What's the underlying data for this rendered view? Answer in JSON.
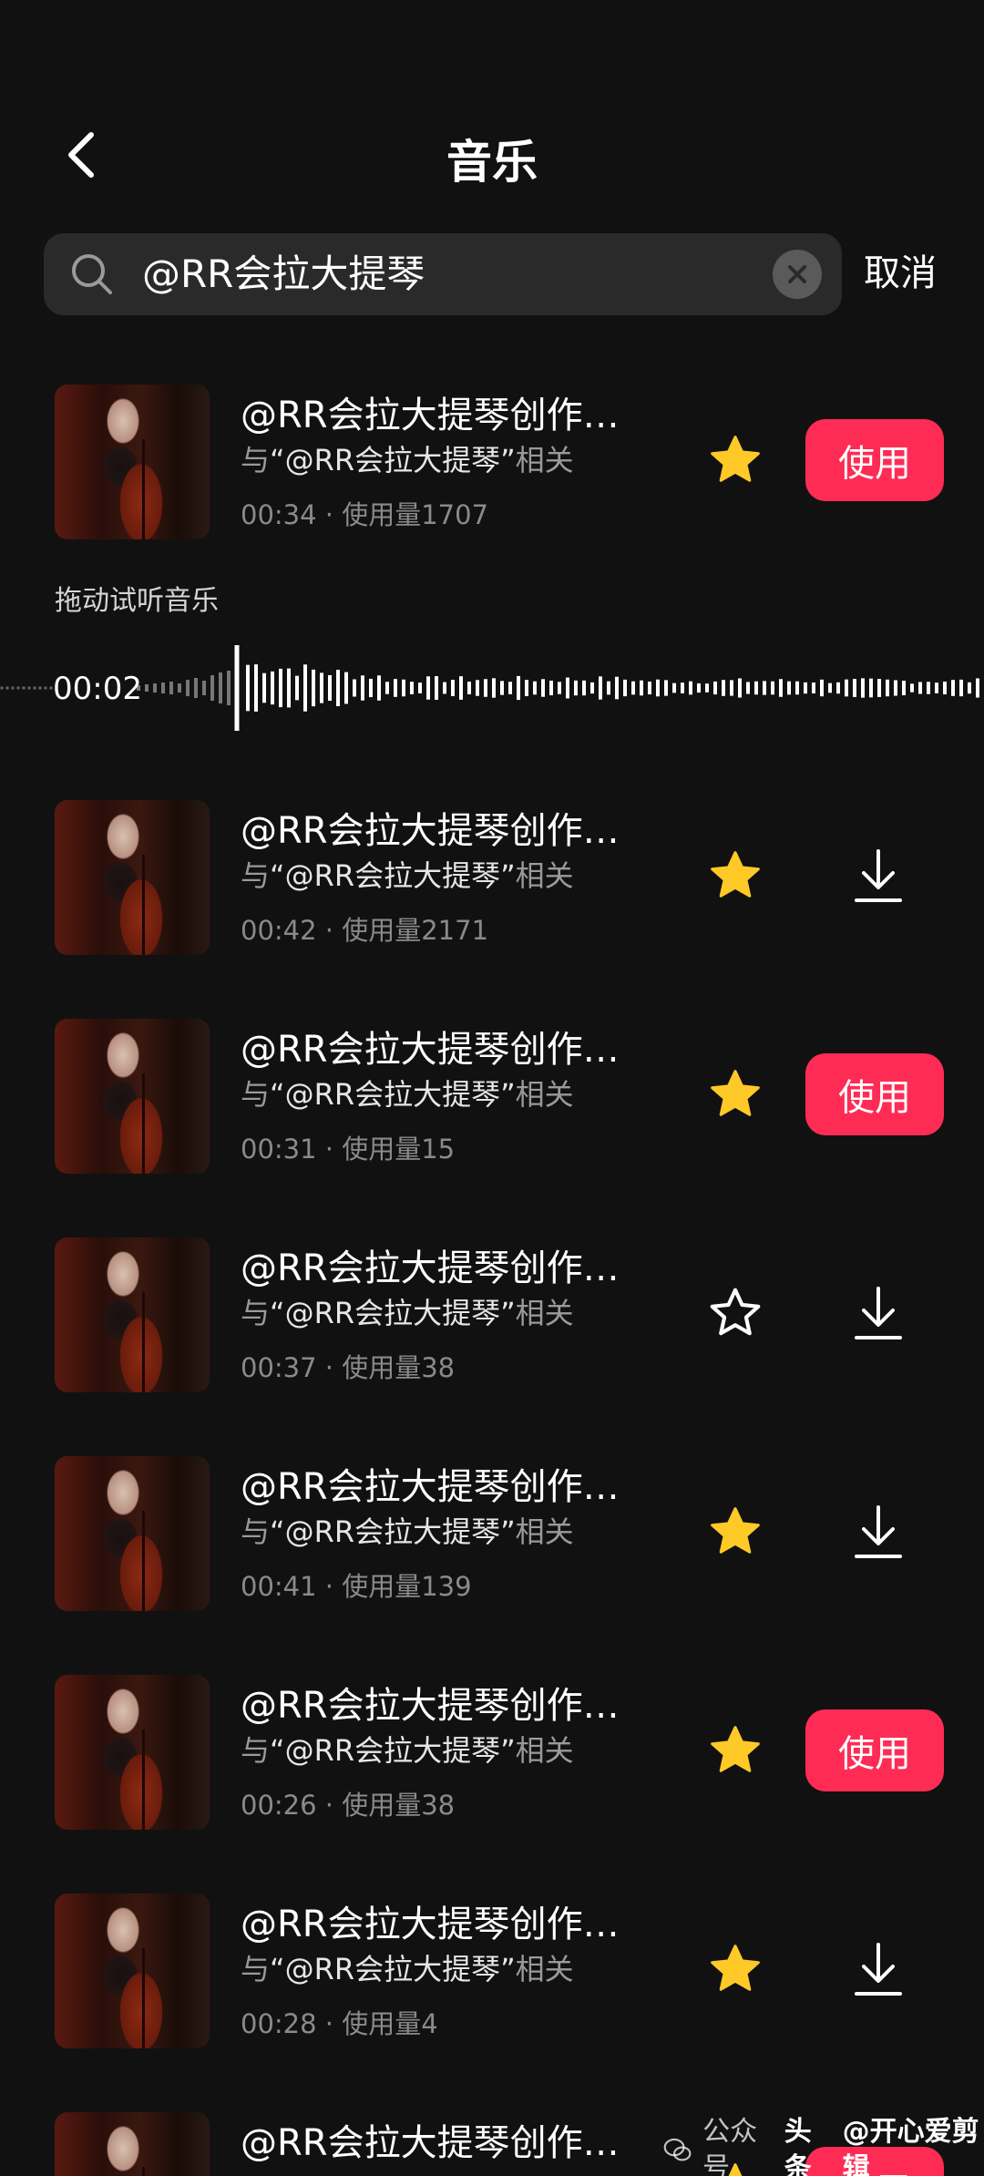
{
  "header": {
    "title": "音乐"
  },
  "search": {
    "value": "@RR会拉大提琴",
    "cancel_label": "取消"
  },
  "preview": {
    "label": "拖动试听音乐",
    "time": "00:02"
  },
  "tracks": [
    {
      "title": "@RR会拉大提琴创作…",
      "sub_prefix": "与",
      "sub_highlight": "“@RR会拉大提琴”",
      "sub_suffix": "相关",
      "duration": "00:34",
      "usage": "使用量1707",
      "favorited": true,
      "action": "use",
      "use_label": "使用"
    },
    {
      "title": "@RR会拉大提琴创作…",
      "sub_prefix": "与",
      "sub_highlight": "“@RR会拉大提琴”",
      "sub_suffix": "相关",
      "duration": "00:42",
      "usage": "使用量2171",
      "favorited": true,
      "action": "download",
      "use_label": ""
    },
    {
      "title": "@RR会拉大提琴创作…",
      "sub_prefix": "与",
      "sub_highlight": "“@RR会拉大提琴”",
      "sub_suffix": "相关",
      "duration": "00:31",
      "usage": "使用量15",
      "favorited": true,
      "action": "use",
      "use_label": "使用"
    },
    {
      "title": "@RR会拉大提琴创作…",
      "sub_prefix": "与",
      "sub_highlight": "“@RR会拉大提琴”",
      "sub_suffix": "相关",
      "duration": "00:37",
      "usage": "使用量38",
      "favorited": false,
      "action": "download",
      "use_label": ""
    },
    {
      "title": "@RR会拉大提琴创作…",
      "sub_prefix": "与",
      "sub_highlight": "“@RR会拉大提琴”",
      "sub_suffix": "相关",
      "duration": "00:41",
      "usage": "使用量139",
      "favorited": true,
      "action": "download",
      "use_label": ""
    },
    {
      "title": "@RR会拉大提琴创作…",
      "sub_prefix": "与",
      "sub_highlight": "“@RR会拉大提琴”",
      "sub_suffix": "相关",
      "duration": "00:26",
      "usage": "使用量38",
      "favorited": true,
      "action": "use",
      "use_label": "使用"
    },
    {
      "title": "@RR会拉大提琴创作…",
      "sub_prefix": "与",
      "sub_highlight": "“@RR会拉大提琴”",
      "sub_suffix": "相关",
      "duration": "00:28",
      "usage": "使用量4",
      "favorited": true,
      "action": "download",
      "use_label": ""
    },
    {
      "title": "@RR会拉大提琴创作…",
      "sub_prefix": "",
      "sub_highlight": "",
      "sub_suffix": "",
      "duration": "",
      "usage": "",
      "favorited": true,
      "action": "use",
      "use_label": "使用"
    }
  ],
  "meta_separator": "·",
  "watermark": {
    "prefix": "公众号",
    "source": "头条",
    "handle": "@开心爱剪辑"
  },
  "colors": {
    "accent": "#fe2c55",
    "star": "#ffc928",
    "background": "#111111"
  },
  "icons": {
    "back": "chevron-left-icon",
    "search": "search-icon",
    "clear": "close-circle-icon",
    "star": "star-icon",
    "download": "download-icon"
  }
}
